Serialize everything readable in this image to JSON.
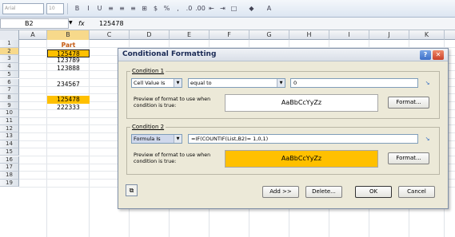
{
  "toolbar": {
    "font_name": "Arial",
    "font_size": "10",
    "items": [
      "B",
      "I",
      "U",
      "≡",
      "≡",
      "≡",
      "⊞",
      "$",
      "%",
      ",",
      ".0",
      ".00",
      "⇤",
      "⇥",
      "□",
      "◆",
      "A"
    ]
  },
  "formula_bar": {
    "name_box": "B2",
    "fx": "fx",
    "value": "125478"
  },
  "columns": [
    "A",
    "B",
    "C",
    "D",
    "E",
    "F",
    "G",
    "H",
    "I",
    "J",
    "K"
  ],
  "rows": [
    "1",
    "2",
    "3",
    "4",
    "5",
    "6",
    "7",
    "8",
    "9",
    "10",
    "11",
    "12",
    "13",
    "14",
    "15",
    "16",
    "17",
    "18",
    "19"
  ],
  "cells": {
    "b1": "Part Numbers",
    "b2": "125478",
    "b3": "123789",
    "b4": "123888",
    "b6": "234567",
    "b8": "125478",
    "b9": "222333"
  },
  "dialog": {
    "title": "Conditional Formatting",
    "help": "?",
    "close": "✕",
    "condition1": {
      "label": "Condition 1",
      "type": "Cell Value Is",
      "operator": "equal to",
      "value": "0",
      "preview_label": "Preview of format to use when condition is true:",
      "preview_text": "AaBbCcYyZz",
      "format_button": "Format..."
    },
    "condition2": {
      "label": "Condition 2",
      "type": "Formula Is",
      "formula": "=IF(COUNTIF(List,B2)= 1,0,1)",
      "preview_label": "Preview of format to use when condition is true:",
      "preview_text": "AaBbCcYyZz",
      "format_button": "Format..."
    },
    "buttons": {
      "add": "Add >>",
      "delete": "Delete...",
      "ok": "OK",
      "cancel": "Cancel"
    }
  },
  "colors": {
    "highlight": "#ffc000",
    "header_text": "#c55a11"
  }
}
